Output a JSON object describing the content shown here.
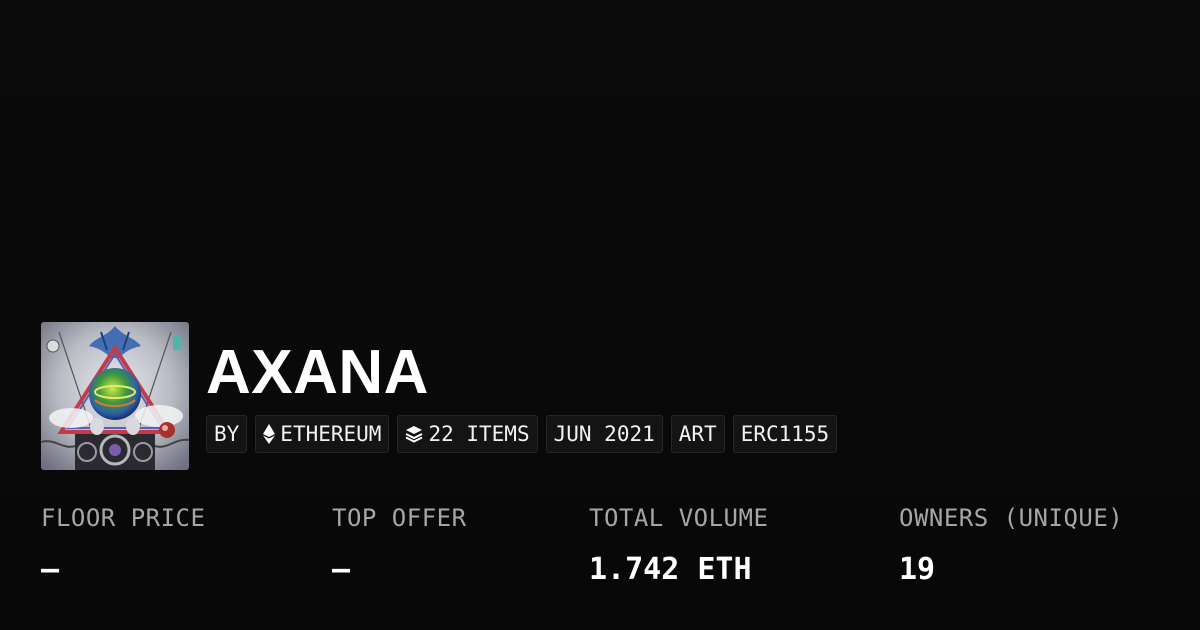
{
  "collection": {
    "name": "AXANA",
    "thumbnail_icon": "collection-artwork",
    "tags": {
      "by": "BY",
      "chain": "ETHEREUM",
      "chain_icon": "ethereum-icon",
      "items": "22 ITEMS",
      "items_icon": "layers-icon",
      "date": "JUN 2021",
      "category": "ART",
      "standard": "ERC1155"
    }
  },
  "stats": [
    {
      "label": "FLOOR PRICE",
      "value": "—"
    },
    {
      "label": "TOP OFFER",
      "value": "—"
    },
    {
      "label": "TOTAL VOLUME",
      "value": "1.742 ETH"
    },
    {
      "label": "OWNERS (UNIQUE)",
      "value": "19"
    }
  ],
  "colors": {
    "background": "#0a0a0a",
    "text": "#ffffff",
    "label": "#a6a6a6",
    "tag_bg": "#141414",
    "tag_border": "#262626"
  }
}
